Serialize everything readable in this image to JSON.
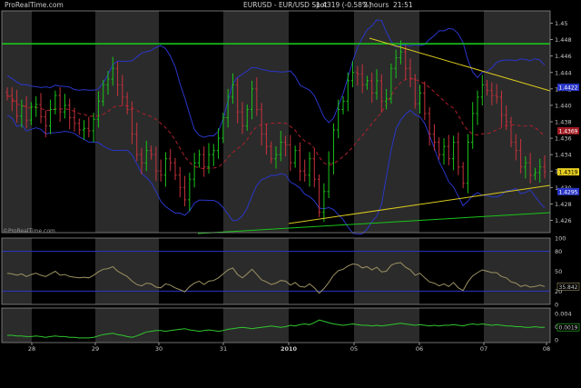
{
  "header": {
    "logo": "ProRealTime.com",
    "symbol": "EURUSD - EUR/USD Spot",
    "quote": "1.4319 (-0.58%)",
    "period": "2 hours",
    "time": "21:51"
  },
  "watermark": "©ProRealTime.com",
  "colors": {
    "background": "#000000",
    "band_light": "#2b2b2b",
    "band_dark": "#000000",
    "up": "#19c419",
    "down": "#c8323c",
    "bollinger": "#2a36c8",
    "ma": "#b0202a",
    "trend_yellow": "#d8c81e",
    "trend_green": "#19c419",
    "resistance": "#19c419",
    "oscillator": "#9c9262",
    "momentum": "#2fc62f",
    "axis_text": "#c9c9c9",
    "panel_border": "#8a8a8a"
  },
  "chart_data": [
    {
      "type": "candlestick",
      "panel": "price",
      "x_labels": [
        "28",
        "29",
        "30",
        "31",
        "2010",
        "05",
        "06",
        "07",
        "08"
      ],
      "y_ticks": [
        1.45,
        1.448,
        1.446,
        1.444,
        1.442,
        1.44,
        1.438,
        1.436,
        1.434,
        1.432,
        1.43,
        1.428,
        1.426
      ],
      "ylim": [
        1.4245,
        1.4515
      ],
      "last_price_label": "1.4319",
      "upper_band_label": "1.4422",
      "ma_label": "1.4369",
      "lower_band_label": "1.4295",
      "resistance_level": 1.4475,
      "closes": [
        1.4412,
        1.4405,
        1.4387,
        1.4399,
        1.4382,
        1.4398,
        1.4401,
        1.4386,
        1.4375,
        1.4395,
        1.4412,
        1.4392,
        1.44,
        1.4385,
        1.4378,
        1.437,
        1.4372,
        1.4369,
        1.4383,
        1.4405,
        1.4425,
        1.4432,
        1.4445,
        1.4425,
        1.441,
        1.4395,
        1.4365,
        1.434,
        1.433,
        1.4345,
        1.434,
        1.432,
        1.4315,
        1.4335,
        1.433,
        1.4315,
        1.43,
        1.4285,
        1.431,
        1.433,
        1.434,
        1.4325,
        1.434,
        1.4345,
        1.436,
        1.4385,
        1.441,
        1.4425,
        1.4392,
        1.4375,
        1.4395,
        1.442,
        1.4395,
        1.4365,
        1.435,
        1.4335,
        1.434,
        1.4355,
        1.4352,
        1.433,
        1.4345,
        1.432,
        1.4315,
        1.4335,
        1.431,
        1.427,
        1.4295,
        1.433,
        1.437,
        1.4395,
        1.4405,
        1.443,
        1.444,
        1.4438,
        1.4425,
        1.443,
        1.4415,
        1.443,
        1.4405,
        1.4408,
        1.4445,
        1.4458,
        1.4465,
        1.4445,
        1.4432,
        1.4402,
        1.4415,
        1.439,
        1.4365,
        1.4355,
        1.434,
        1.435,
        1.4335,
        1.4355,
        1.4325,
        1.4305,
        1.4355,
        1.439,
        1.441,
        1.4425,
        1.4418,
        1.4412,
        1.441,
        1.4388,
        1.438,
        1.4355,
        1.4345,
        1.4325,
        1.433,
        1.4315,
        1.4318,
        1.4325,
        1.4319
      ]
    },
    {
      "type": "line",
      "panel": "oscillator",
      "y_ticks": [
        100,
        80,
        50,
        20,
        0
      ],
      "ylim": [
        0,
        100
      ],
      "value_label": "35.842",
      "levels": [
        80,
        20
      ],
      "values": [
        47,
        46,
        44,
        46,
        42,
        45,
        47,
        44,
        42,
        46,
        50,
        44,
        45,
        42,
        41,
        40,
        41,
        40,
        44,
        49,
        53,
        54,
        57,
        50,
        46,
        42,
        35,
        30,
        28,
        32,
        31,
        26,
        25,
        31,
        29,
        25,
        22,
        19,
        27,
        32,
        35,
        30,
        35,
        36,
        40,
        46,
        52,
        55,
        45,
        40,
        46,
        53,
        45,
        37,
        34,
        30,
        32,
        36,
        35,
        29,
        33,
        27,
        26,
        31,
        25,
        17,
        24,
        33,
        44,
        51,
        53,
        58,
        61,
        60,
        55,
        57,
        52,
        56,
        49,
        50,
        59,
        62,
        63,
        56,
        52,
        44,
        47,
        40,
        34,
        32,
        28,
        31,
        27,
        33,
        25,
        21,
        34,
        43,
        48,
        52,
        50,
        48,
        48,
        42,
        40,
        34,
        32,
        27,
        29,
        26,
        27,
        29,
        27
      ]
    },
    {
      "type": "line",
      "panel": "momentum",
      "y_ticks": [
        0.004,
        0.002,
        0
      ],
      "ylim": [
        -0.0004,
        0.0048
      ],
      "value_label": "0.0019",
      "values": [
        0.0007,
        0.0007,
        0.0006,
        0.0006,
        0.0005,
        0.0005,
        0.0006,
        0.0005,
        0.0004,
        0.0005,
        0.0006,
        0.0005,
        0.0005,
        0.0004,
        0.0004,
        0.0003,
        0.0003,
        0.0003,
        0.0004,
        0.0006,
        0.0008,
        0.0009,
        0.001,
        0.0008,
        0.0007,
        0.0005,
        0.0004,
        0.0006,
        0.0009,
        0.0012,
        0.0013,
        0.0014,
        0.0014,
        0.0013,
        0.0014,
        0.0015,
        0.0016,
        0.0017,
        0.0015,
        0.0014,
        0.0013,
        0.0014,
        0.0015,
        0.0014,
        0.0013,
        0.0014,
        0.0016,
        0.0017,
        0.0018,
        0.0019,
        0.0018,
        0.0017,
        0.0018,
        0.0019,
        0.002,
        0.0021,
        0.002,
        0.0019,
        0.002,
        0.0022,
        0.0021,
        0.0023,
        0.0024,
        0.0023,
        0.0026,
        0.003,
        0.0028,
        0.0026,
        0.0024,
        0.0023,
        0.0022,
        0.0023,
        0.0024,
        0.0023,
        0.0022,
        0.0022,
        0.0021,
        0.0022,
        0.0021,
        0.0022,
        0.0023,
        0.0024,
        0.0025,
        0.0024,
        0.0023,
        0.0022,
        0.0023,
        0.0022,
        0.0021,
        0.0022,
        0.0021,
        0.0022,
        0.0022,
        0.0023,
        0.0022,
        0.0021,
        0.0023,
        0.0024,
        0.0023,
        0.0024,
        0.0023,
        0.0022,
        0.0023,
        0.0022,
        0.0021,
        0.0021,
        0.002,
        0.002,
        0.0019,
        0.0019,
        0.002,
        0.0019,
        0.0019
      ]
    }
  ]
}
